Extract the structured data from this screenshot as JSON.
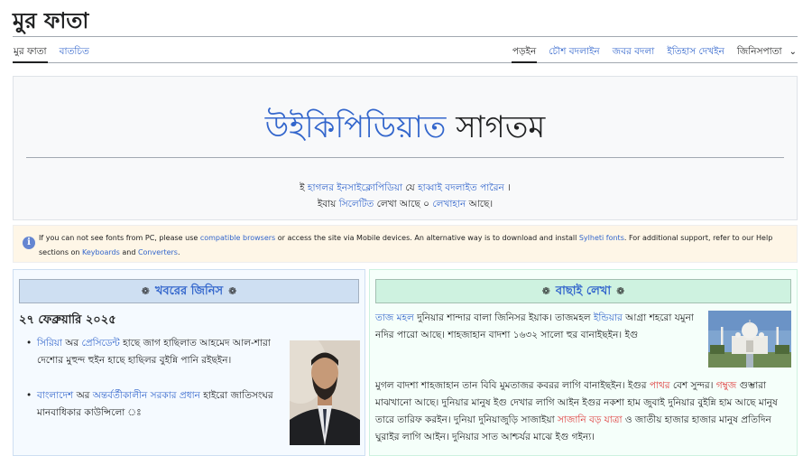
{
  "header": {
    "title": "মুর ফাতা"
  },
  "tabs": {
    "left": [
      {
        "label": "মুর ফাতা",
        "selected": true
      },
      {
        "label": "বাতচিত",
        "selected": false
      }
    ],
    "right": [
      {
        "label": "পড়ইন",
        "selected": true
      },
      {
        "label": "চৌশ বদলাইন",
        "selected": false
      },
      {
        "label": "জবর বদলা",
        "selected": false
      },
      {
        "label": "ইতিহাস দেখইন",
        "selected": false
      },
      {
        "label": "জিনিসপাতা",
        "selected": false,
        "has_chevron": true
      }
    ]
  },
  "banner": {
    "welcome_link": "উইকিপিডিয়াত",
    "welcome_rest": "সাগতম",
    "line1_prefix": "ই",
    "line1_link1": "হাগলর ইনসাইক্লোপিডিয়া",
    "line1_mid": "যে",
    "line1_link2": "হাব্বাই বদলাইত পারৈন",
    "line1_suffix": "।",
    "line2_prefix": "ইবায়",
    "line2_link1": "সিলেটিত",
    "line2_mid": "লেখা আছে ০",
    "line2_link2": "লেখাহান",
    "line2_suffix": "আছে।"
  },
  "notice": {
    "text1": "If you can not see fonts from PC, please use ",
    "link1": "compatible browsers",
    "text2": " or access the site via Mobile devices. An alternative way is to download and install ",
    "link2": "Sylheti fonts",
    "text3": ". For additional support, refer to our Help sections on ",
    "link3": "Keyboards",
    "text4": " and ",
    "link4": "Converters",
    "text5": "."
  },
  "news": {
    "heading": "খবরের জিনিস",
    "date": "২৭ ফেব্রুয়ারি ২০২৫",
    "items": [
      {
        "link1": "সিরিয়া",
        "t1": " অর ",
        "link2": "প্রেসিডেন্ট",
        "t2": " হাছে জাগ হাছিলাত আহমেদ আল-শারা দেশোর মুহুন্দ হুইন হাছে হাছিলর বুইন্নি পানি রইছইন।"
      },
      {
        "link1": "বাংলাদেশ",
        "t1": " অর ",
        "link2": "অন্তর্বর্তীকালীন সরকার প্রধান",
        "t2": " হাইরো জাতিসংঘর মানবাধিকার কাউন্সিলো ঃ"
      }
    ]
  },
  "featured": {
    "heading": "বাছাই লেখা",
    "para1_link1": "তাজ মহল",
    "para1_t1": " দুনিয়ার শান্দার বালা জিনিসর ইয়াক। তাজমহল ",
    "para1_link2": "ইন্ডিয়ার",
    "para1_t2": " আগ্রা শহরো যমুনা নদির পারো আছে। শাহজাহান বাদশা ১৬৩২ সালো হুর বানাইছইন। ইগু ",
    "para2_t1": "মুগল বাদশা শাহজাহান তান বিবি মুমতাজর কবরর লাগি বানাইছইন। ইগুর ",
    "para2_red1": "পাথর",
    "para2_t2": " বেশ সুন্দর। ",
    "para2_red2": "গম্বুজ",
    "para2_t3": " গুম্ভারা মাঝখানো আছে। দুনিয়ার মানুষ ইগু দেখার লাগি আইন ইগুর নকশা হাম জুবাই দুনিয়ার বুইন্নি হাম আছে মানুষ তারে তারিফ করইন। দুনিয়া দুনিয়াজুড়ি সাজাইয়া ",
    "para2_red3": "সাজানি বড় যাত্রা",
    "para2_t4": " ও জাতীয় হাজার হাজার মানুষ প্রতিদিন ঘুরাইর লাগি আইন। দুনিয়ার সাত আশ্চর্যর মাঝে ইগু গইন্য।"
  },
  "colors": {
    "link": "#3366cc",
    "red_link": "#dd3333",
    "news_bg": "#f5faff",
    "news_head": "#cedff2",
    "featured_bg": "#f5fffa",
    "featured_head": "#cef2e0",
    "notice_bg": "#fef6e7"
  }
}
